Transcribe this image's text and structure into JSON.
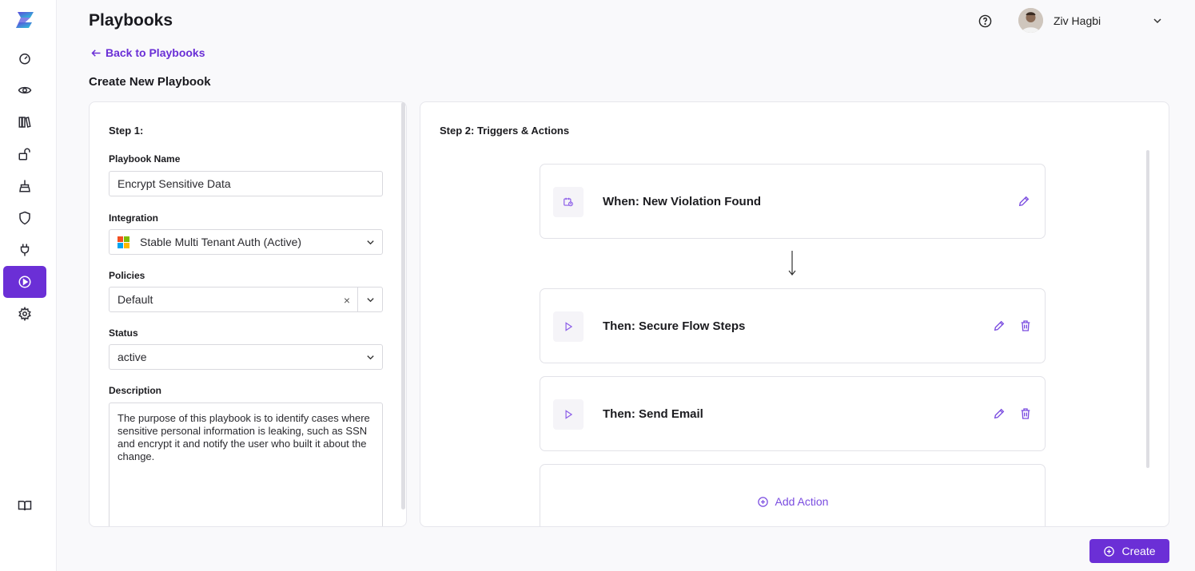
{
  "header": {
    "title": "Playbooks",
    "back_label": "Back to Playbooks",
    "subtitle": "Create New Playbook"
  },
  "user": {
    "name": "Ziv Hagbi"
  },
  "sidebar": {
    "items": [
      {
        "icon": "dashboard-gauge-icon",
        "active": false
      },
      {
        "icon": "eye-icon",
        "active": false
      },
      {
        "icon": "library-books-icon",
        "active": false
      },
      {
        "icon": "unlock-icon",
        "active": false
      },
      {
        "icon": "broom-icon",
        "active": false
      },
      {
        "icon": "shield-icon",
        "active": false
      },
      {
        "icon": "plug-icon",
        "active": false
      },
      {
        "icon": "play-circle-icon",
        "active": true
      },
      {
        "icon": "gear-icon",
        "active": false
      }
    ],
    "bottom_icon": "book-open-icon"
  },
  "step1": {
    "title": "Step 1:",
    "name_label": "Playbook Name",
    "name_value": "Encrypt Sensitive Data",
    "integration_label": "Integration",
    "integration_value": "Stable Multi Tenant Auth (Active)",
    "policies_label": "Policies",
    "policies_value": "Default",
    "policies_clear": "×",
    "status_label": "Status",
    "status_value": "active",
    "description_label": "Description",
    "description_value": "The purpose of this playbook is to identify cases where sensitive personal information is leaking, such as SSN and encrypt it and notify the user who built it about the change."
  },
  "step2": {
    "title": "Step 2: Triggers & Actions",
    "trigger": {
      "label": "When: New Violation Found",
      "icon": "calendar-clock-icon"
    },
    "actions": [
      {
        "label": "Then: Secure Flow Steps",
        "icon": "play-icon"
      },
      {
        "label": "Then: Send Email",
        "icon": "play-icon"
      }
    ],
    "add_action_label": "Add Action"
  },
  "footer": {
    "create_label": "Create"
  },
  "colors": {
    "accent": "#6b2fd6",
    "text": "#1b1b1f",
    "border": "#e2e2e8"
  }
}
